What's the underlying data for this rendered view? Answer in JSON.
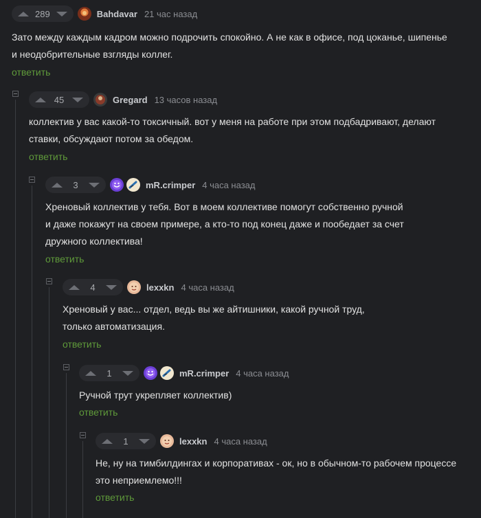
{
  "reply_label": "ответить",
  "comments": [
    {
      "rating": "289",
      "author": "Bahdavar",
      "time": "21 час назад",
      "lines": [
        "Зато между каждым кадром можно подрочить спокойно. А не как в офисе, под цоканье, шипенье",
        "и неодобрительные взгляды коллег."
      ]
    },
    {
      "rating": "45",
      "author": "Gregard",
      "time": "13 часов назад",
      "lines": [
        "коллектив у вас какой-то токсичный. вот у меня на работе при этом подбадривают, делают",
        "ставки, обсуждают потом за обедом."
      ]
    },
    {
      "rating": "3",
      "author": "mR.crimper",
      "time": "4 часа назад",
      "lines": [
        "Хреновый коллектив у тебя. Вот в моем коллективе помогут собственно ручной",
        "и даже покажут на своем примере, а кто-то под конец даже и пообедает за счет",
        "дружного коллектива!"
      ]
    },
    {
      "rating": "4",
      "author": "lexxkn",
      "time": "4 часа назад",
      "lines": [
        "Хреновый у вас... отдел, ведь вы же айтишники, какой ручной труд,",
        "только автоматизация."
      ]
    },
    {
      "rating": "1",
      "author": "mR.crimper",
      "time": "4 часа назад",
      "lines": [
        "Ручной трут укрепляет коллектив)"
      ]
    },
    {
      "rating": "1",
      "author": "lexxkn",
      "time": "4 часа назад",
      "lines": [
        "Не, ну на тимбилдингах и корпоративах - ок, но в обычном-то рабочем процессе",
        "это неприемлемо!!!"
      ]
    }
  ],
  "colors": {
    "background": "#1f2023",
    "reply": "#5f9a3a",
    "vote_box": "#2a2b2f"
  },
  "icons": [
    "arrow-up-icon",
    "arrow-down-icon",
    "collapse-icon",
    "avatar-icon",
    "badge-icon"
  ]
}
